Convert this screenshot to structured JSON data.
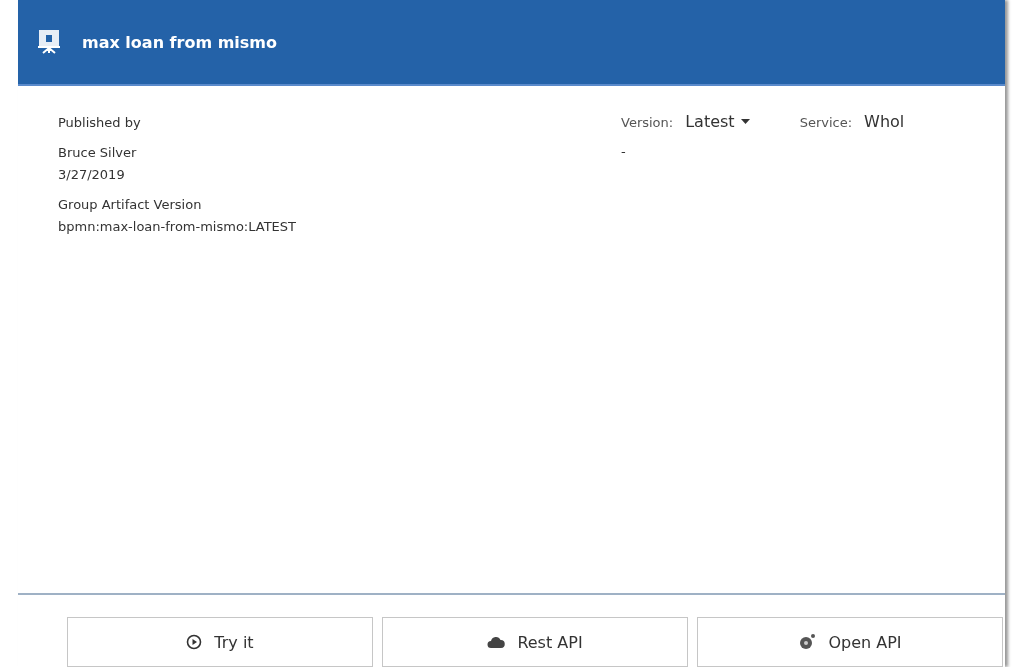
{
  "header": {
    "title": "max loan from mismo"
  },
  "published": {
    "label": "Published by",
    "author": "Bruce Silver",
    "date": "3/27/2019"
  },
  "gav": {
    "label": "Group Artifact Version",
    "value": "bpmn:max-loan-from-mismo:LATEST"
  },
  "version": {
    "label": "Version:",
    "value": "Latest",
    "note": "-"
  },
  "service": {
    "label": "Service:",
    "value": "Whol"
  },
  "buttons": [
    {
      "kind": "try",
      "label": "Try it"
    },
    {
      "kind": "rest",
      "label": "Rest API"
    },
    {
      "kind": "open",
      "label": "Open API"
    }
  ]
}
